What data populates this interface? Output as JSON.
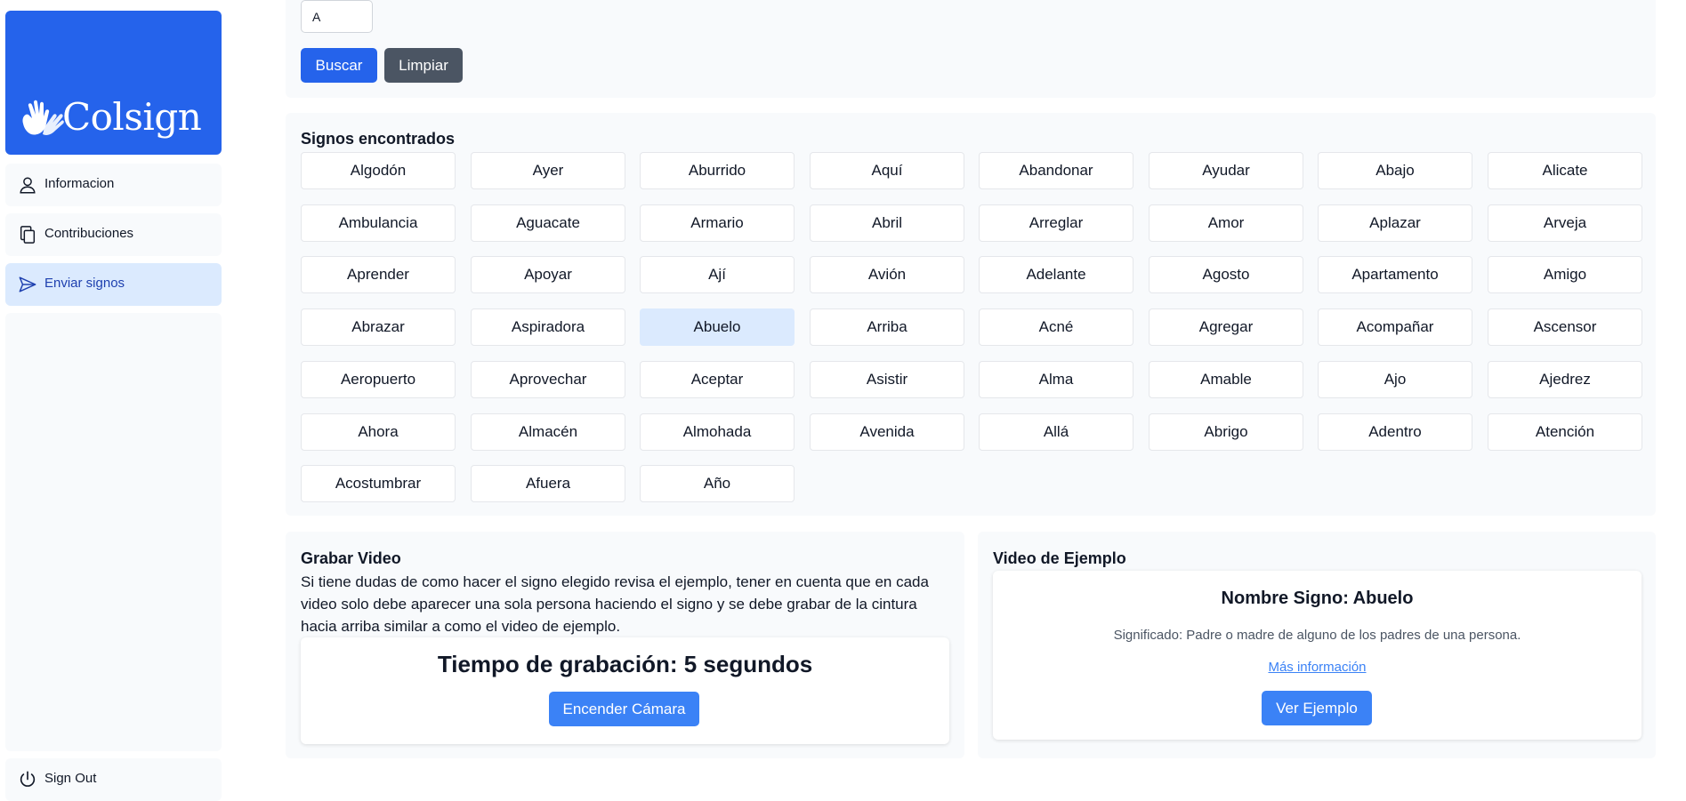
{
  "brand": {
    "name": "Colsign"
  },
  "sidebar": {
    "items": [
      {
        "label": "Informacion",
        "icon": "user-icon"
      },
      {
        "label": "Contribuciones",
        "icon": "copy-icon"
      },
      {
        "label": "Enviar signos",
        "icon": "send-icon",
        "active": true
      }
    ],
    "sign_out": {
      "label": "Sign Out",
      "icon": "power-icon"
    }
  },
  "search": {
    "letter_value": "A",
    "search_label": "Buscar",
    "clear_label": "Limpiar"
  },
  "signs": {
    "title": "Signos encontrados",
    "selected": "Abuelo",
    "items": [
      "Algodón",
      "Ayer",
      "Aburrido",
      "Aquí",
      "Abandonar",
      "Ayudar",
      "Abajo",
      "Alicate",
      "Ambulancia",
      "Aguacate",
      "Armario",
      "Abril",
      "Arreglar",
      "Amor",
      "Aplazar",
      "Arveja",
      "Aprender",
      "Apoyar",
      "Ají",
      "Avión",
      "Adelante",
      "Agosto",
      "Apartamento",
      "Amigo",
      "Abrazar",
      "Aspiradora",
      "Abuelo",
      "Arriba",
      "Acné",
      "Agregar",
      "Acompañar",
      "Ascensor",
      "Aeropuerto",
      "Aprovechar",
      "Aceptar",
      "Asistir",
      "Alma",
      "Amable",
      "Ajo",
      "Ajedrez",
      "Ahora",
      "Almacén",
      "Almohada",
      "Avenida",
      "Allá",
      "Abrigo",
      "Adentro",
      "Atención",
      "Acostumbrar",
      "Afuera",
      "Año"
    ]
  },
  "record": {
    "title": "Grabar Video",
    "description": "Si tiene dudas de como hacer el signo elegido revisa el ejemplo, tener en cuenta que en cada video solo debe aparecer una sola persona haciendo el signo y se debe grabar de la cintura hacia arriba similar a como el video de ejemplo.",
    "time_label": "Tiempo de grabación: 5 segundos",
    "camera_button": "Encender Cámara"
  },
  "example": {
    "title": "Video de Ejemplo",
    "name": "Nombre Signo: Abuelo",
    "meaning": "Significado: Padre o madre de alguno de los padres de una persona.",
    "more_info": "Más información",
    "button": "Ver Ejemplo"
  },
  "colors": {
    "primary": "#2563eb",
    "secondary": "#4b5563",
    "selected_bg": "#dbeafe",
    "panel_bg": "#f8fafc"
  }
}
